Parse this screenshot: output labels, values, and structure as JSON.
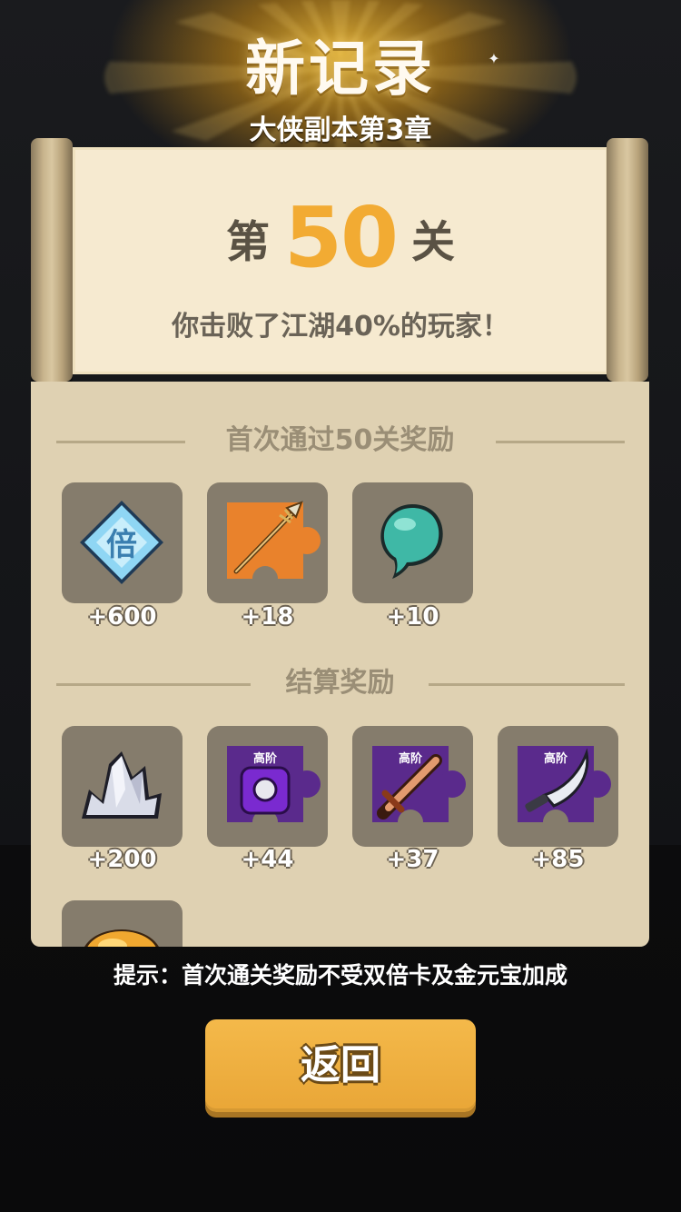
{
  "header": {
    "title": "新记录",
    "subtitle": "大侠副本第3章"
  },
  "scroll": {
    "stage_prefix": "第",
    "stage_number": "50",
    "stage_suffix": "关",
    "beat_text": "你击败了江湖40%的玩家！"
  },
  "first_clear": {
    "label": "首次通过50关奖励",
    "items": [
      {
        "icon": "double-card-icon",
        "badge": "倍",
        "qty": "+600"
      },
      {
        "icon": "spear-fragment-icon",
        "qty": "+18"
      },
      {
        "icon": "jade-bead-icon",
        "qty": "+10"
      }
    ]
  },
  "settlement": {
    "label": "结算奖励",
    "items": [
      {
        "icon": "crystal-icon",
        "qty": "+200"
      },
      {
        "icon": "armor-fragment-icon",
        "tag": "高阶",
        "qty": "+44"
      },
      {
        "icon": "sword-fragment-icon",
        "tag": "高阶",
        "qty": "+37"
      },
      {
        "icon": "saber-fragment-icon",
        "tag": "高阶",
        "qty": "+85"
      },
      {
        "icon": "gold-ingot-icon",
        "qty": ""
      }
    ]
  },
  "hint": "提示：首次通关奖励不受双倍卡及金元宝加成",
  "back_button": "返回",
  "colors": {
    "accent": "#f2ab33",
    "panel": "#dfd1b2",
    "paper": "#f6ead0",
    "slot": "#857c6c",
    "purple": "#5a2a8c",
    "orange": "#e9822c"
  }
}
